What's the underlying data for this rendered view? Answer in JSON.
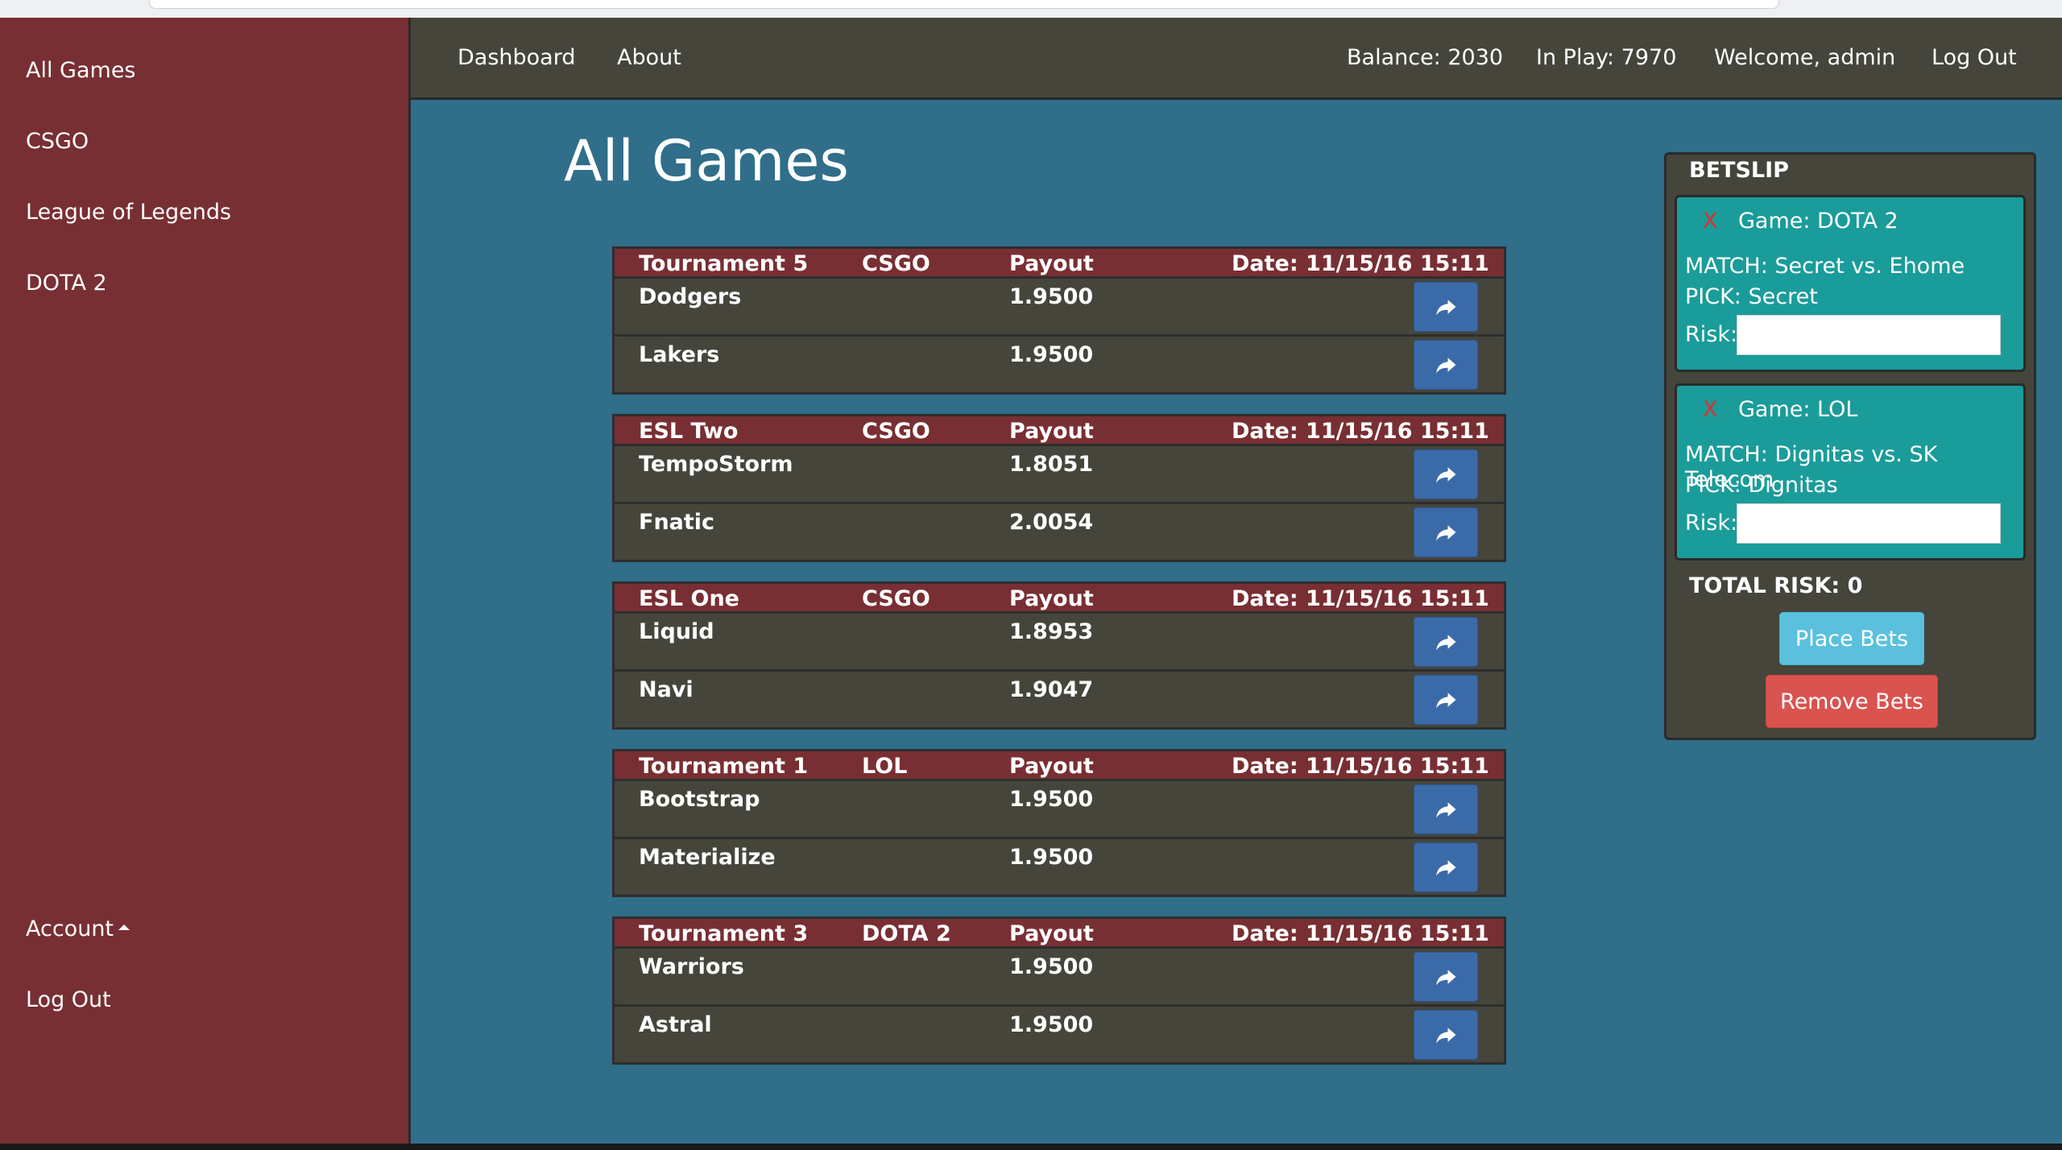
{
  "sidebar": {
    "items": [
      {
        "label": "All Games"
      },
      {
        "label": "CSGO"
      },
      {
        "label": "League of Legends"
      },
      {
        "label": "DOTA 2"
      }
    ],
    "account_label": "Account",
    "logout_label": "Log Out"
  },
  "topnav": {
    "dashboard": "Dashboard",
    "about": "About",
    "balance": "Balance: 2030",
    "in_play": "In Play: 7970",
    "welcome": "Welcome, admin",
    "logout": "Log Out"
  },
  "main": {
    "title": "All Games",
    "matches": [
      {
        "tournament": "Tournament 5",
        "game": "CSGO",
        "payout_label": "Payout",
        "date": "Date: 11/15/16 15:11",
        "teams": [
          {
            "name": "Dodgers",
            "payout": "1.9500"
          },
          {
            "name": "Lakers",
            "payout": "1.9500"
          }
        ]
      },
      {
        "tournament": "ESL Two",
        "game": "CSGO",
        "payout_label": "Payout",
        "date": "Date: 11/15/16 15:11",
        "teams": [
          {
            "name": "TempoStorm",
            "payout": "1.8051"
          },
          {
            "name": "Fnatic",
            "payout": "2.0054"
          }
        ]
      },
      {
        "tournament": "ESL One",
        "game": "CSGO",
        "payout_label": "Payout",
        "date": "Date: 11/15/16 15:11",
        "teams": [
          {
            "name": "Liquid",
            "payout": "1.8953"
          },
          {
            "name": "Navi",
            "payout": "1.9047"
          }
        ]
      },
      {
        "tournament": "Tournament 1",
        "game": "LOL",
        "payout_label": "Payout",
        "date": "Date: 11/15/16 15:11",
        "teams": [
          {
            "name": "Bootstrap",
            "payout": "1.9500"
          },
          {
            "name": "Materialize",
            "payout": "1.9500"
          }
        ]
      },
      {
        "tournament": "Tournament 3",
        "game": "DOTA 2",
        "payout_label": "Payout",
        "date": "Date: 11/15/16 15:11",
        "teams": [
          {
            "name": "Warriors",
            "payout": "1.9500"
          },
          {
            "name": "Astral",
            "payout": "1.9500"
          }
        ]
      }
    ]
  },
  "betslip": {
    "title": "BETSLIP",
    "bets": [
      {
        "remove": "X",
        "game": "Game: DOTA 2",
        "match": "MATCH: Secret vs. Ehome",
        "pick": "PICK: Secret",
        "risk_label": "Risk:",
        "risk_value": ""
      },
      {
        "remove": "X",
        "game": "Game: LOL",
        "match": "MATCH: Dignitas vs. SK Telecom",
        "pick": "PICK: Dignitas",
        "risk_label": "Risk:",
        "risk_value": ""
      }
    ],
    "total_risk": "TOTAL RISK: 0",
    "place_label": "Place Bets",
    "remove_label": "Remove Bets"
  },
  "icons": {
    "bet_button": "share-arrow-icon",
    "account_caret": "caret-up-icon"
  },
  "colors": {
    "sidebar_bg": "#782f33",
    "nav_bg": "#46453b",
    "main_bg": "#306e8a",
    "bet_button": "#3b6aa8",
    "card_bg": "#1a9c9a",
    "place_button": "#5bc0de",
    "remove_button": "#d9534f"
  }
}
